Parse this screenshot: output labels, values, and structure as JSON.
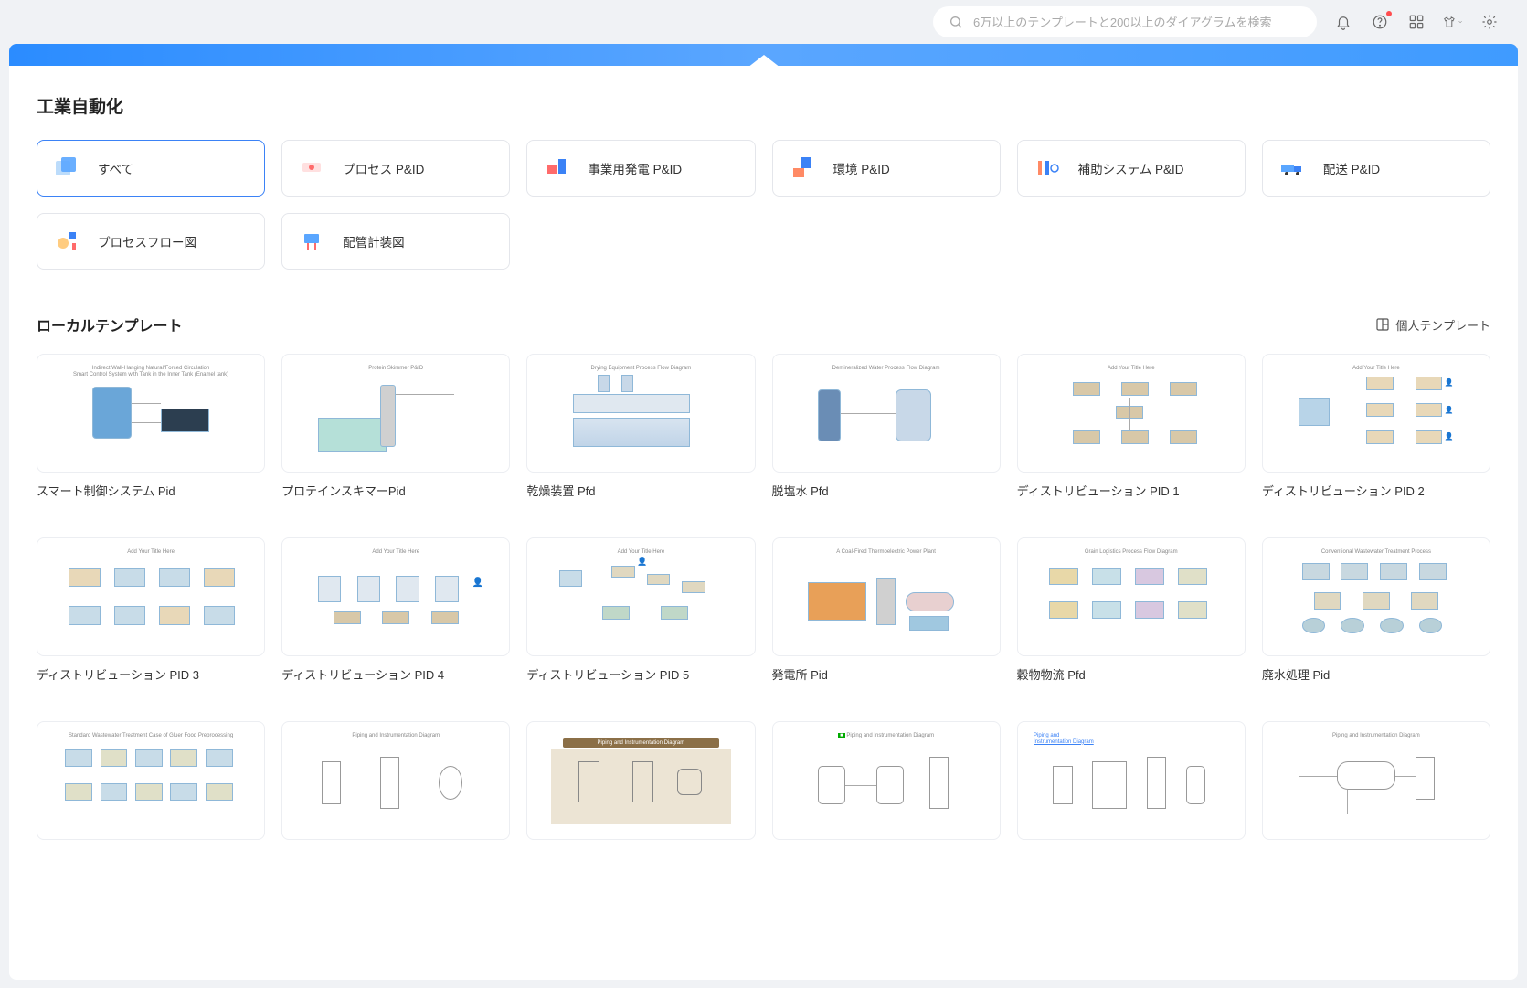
{
  "search": {
    "placeholder": "6万以上のテンプレートと200以上のダイアグラムを検索"
  },
  "page_title": "工業自動化",
  "categories": [
    {
      "label": "すべて",
      "active": true,
      "icon": "all"
    },
    {
      "label": "プロセス P&ID",
      "active": false,
      "icon": "process"
    },
    {
      "label": "事業用発電 P&ID",
      "active": false,
      "icon": "power"
    },
    {
      "label": "環境 P&ID",
      "active": false,
      "icon": "env"
    },
    {
      "label": "補助システム P&ID",
      "active": false,
      "icon": "aux"
    },
    {
      "label": "配送 P&ID",
      "active": false,
      "icon": "deliver"
    },
    {
      "label": "プロセスフロー図",
      "active": false,
      "icon": "pfd"
    },
    {
      "label": "配管計装図",
      "active": false,
      "icon": "pid"
    }
  ],
  "section": {
    "title": "ローカルテンプレート",
    "link": "個人テンプレート"
  },
  "templates": [
    {
      "name": "スマート制御システム Pid",
      "thumb": "smart"
    },
    {
      "name": "プロテインスキマーPid",
      "thumb": "protein"
    },
    {
      "name": "乾燥装置 Pfd",
      "thumb": "dry"
    },
    {
      "name": "脱塩水 Pfd",
      "thumb": "desalt"
    },
    {
      "name": "ディストリビューション PID 1",
      "thumb": "dist1"
    },
    {
      "name": "ディストリビューション PID 2",
      "thumb": "dist2"
    },
    {
      "name": "ディストリビューション PID 3",
      "thumb": "dist3"
    },
    {
      "name": "ディストリビューション PID 4",
      "thumb": "dist4"
    },
    {
      "name": "ディストリビューション PID 5",
      "thumb": "dist5"
    },
    {
      "name": "発電所 Pid",
      "thumb": "plant"
    },
    {
      "name": "穀物物流 Pfd",
      "thumb": "grain"
    },
    {
      "name": "廃水処理 Pid",
      "thumb": "waste"
    },
    {
      "name": "",
      "thumb": "t13"
    },
    {
      "name": "",
      "thumb": "t14"
    },
    {
      "name": "",
      "thumb": "t15"
    },
    {
      "name": "",
      "thumb": "t16"
    },
    {
      "name": "",
      "thumb": "t17"
    },
    {
      "name": "",
      "thumb": "t18"
    }
  ]
}
